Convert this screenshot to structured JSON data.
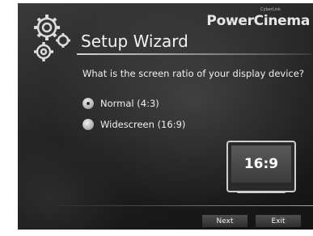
{
  "brand": {
    "name": "PowerCinema",
    "tagline": "CyberLink"
  },
  "header": {
    "title": "Setup Wizard"
  },
  "question": "What is the screen ratio of your display device?",
  "options": [
    {
      "label": "Normal (4:3)",
      "checked": true
    },
    {
      "label": "Widescreen (16:9)",
      "checked": false
    }
  ],
  "preview": {
    "label": "16:9"
  },
  "buttons": {
    "next": "Next",
    "exit": "Exit"
  },
  "icons": [
    "gears-icon",
    "radio-selected-icon",
    "radio-unselected-icon",
    "monitor-icon"
  ]
}
